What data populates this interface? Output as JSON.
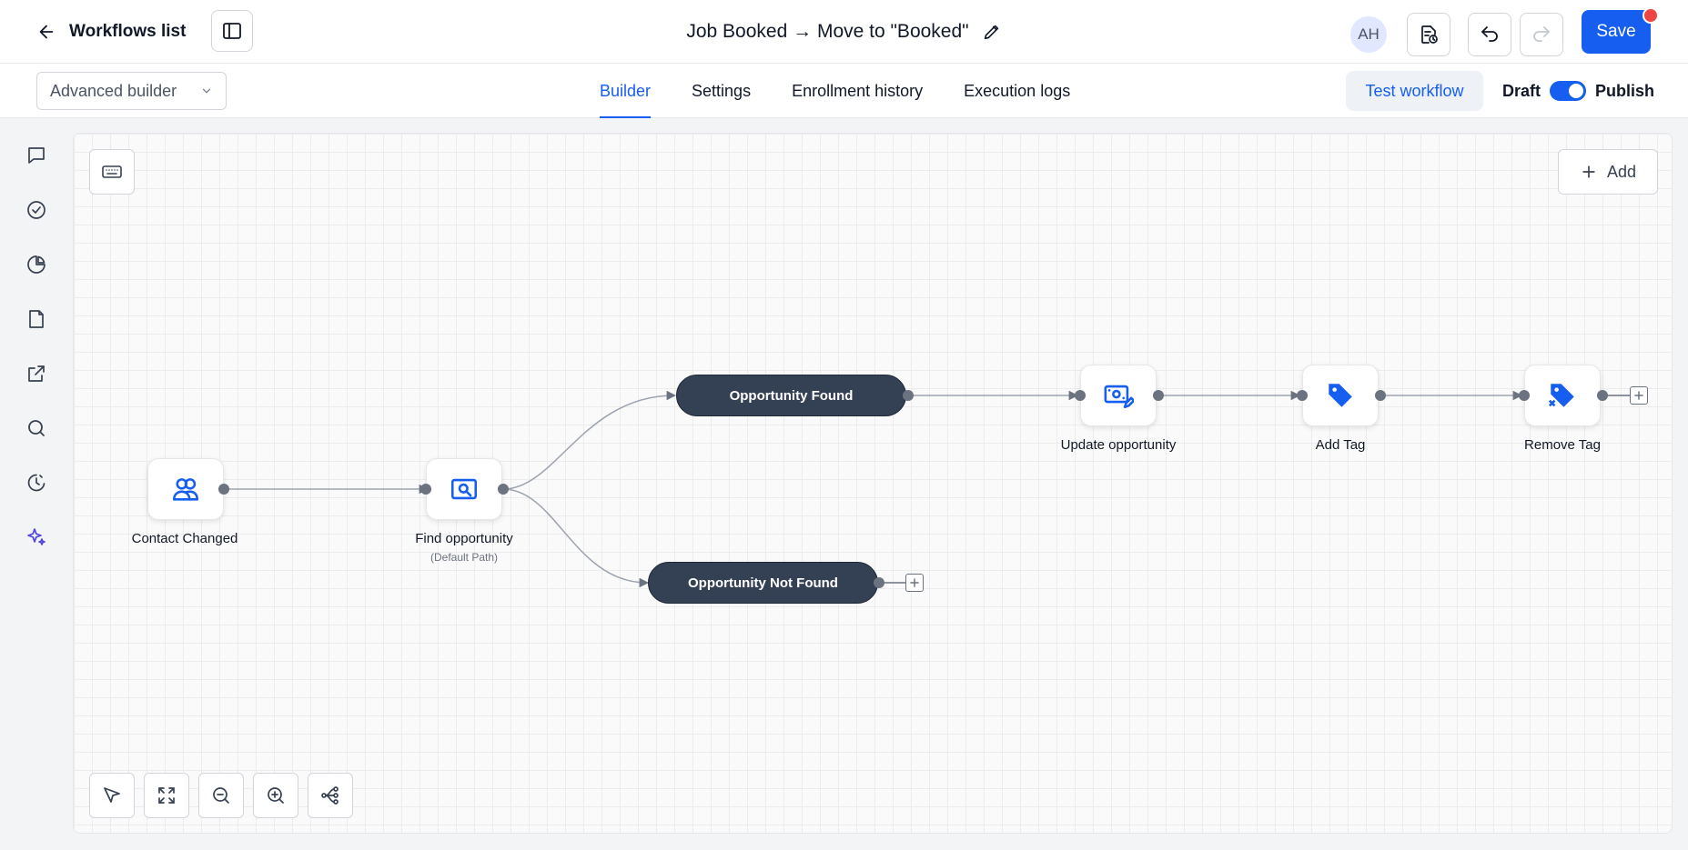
{
  "header": {
    "back_label": "Workflows list",
    "workflow_title": "Job Booked → Move to \"Booked\"",
    "avatar_initials": "AH",
    "save_label": "Save"
  },
  "subbar": {
    "builder_mode": "Advanced builder",
    "tabs": [
      {
        "label": "Builder",
        "active": true
      },
      {
        "label": "Settings",
        "active": false
      },
      {
        "label": "Enrollment history",
        "active": false
      },
      {
        "label": "Execution logs",
        "active": false
      }
    ],
    "test_label": "Test workflow",
    "draft_label": "Draft",
    "publish_label": "Publish",
    "published": true
  },
  "canvas": {
    "add_label": "Add",
    "nodes": {
      "trigger": {
        "label": "Contact Changed",
        "icon": "users-icon"
      },
      "find": {
        "label": "Find opportunity",
        "sub": "(Default Path)",
        "icon": "search-card-icon"
      },
      "found": {
        "label": "Opportunity Found"
      },
      "not_found": {
        "label": "Opportunity Not Found"
      },
      "update": {
        "label": "Update opportunity",
        "icon": "money-edit-icon"
      },
      "add_tag": {
        "label": "Add Tag",
        "icon": "tag-icon"
      },
      "remove_tag": {
        "label": "Remove Tag",
        "icon": "tag-remove-icon"
      }
    }
  },
  "colors": {
    "accent": "#155eef",
    "pill": "#344054",
    "badge": "#ef4444"
  }
}
